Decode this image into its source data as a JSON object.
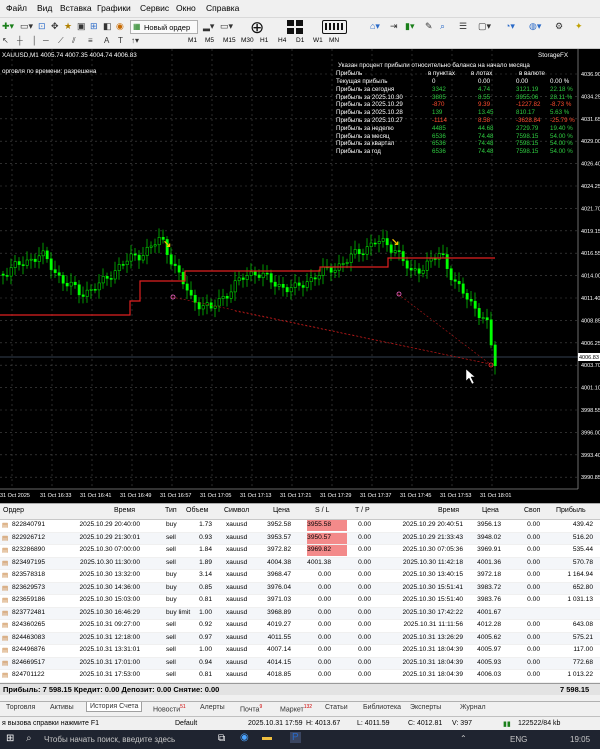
{
  "menu": [
    "Файл",
    "Вид",
    "Вставка",
    "Графики",
    "Сервис",
    "Окно",
    "Справка"
  ],
  "toolbar": {
    "new_order": "Новый ордер"
  },
  "timeframes": [
    "M1",
    "M5",
    "M15",
    "M30",
    "H1",
    "H4",
    "D1",
    "W1",
    "MN"
  ],
  "chart": {
    "title": "XAUUSD,M1 4005.74 4007.35 4004.74 4006.83",
    "subtitle": "орговля по времени: разрешена",
    "indicator": "StorageFX",
    "price_axis": [
      "4036.90",
      "4034.25",
      "4031.65",
      "4029.00",
      "4026.40",
      "4024.25",
      "4021.70",
      "4019.15",
      "4016.55",
      "4014.00",
      "4011.40",
      "4008.85",
      "4006.25",
      "4003.70",
      "4001.10",
      "3998.55",
      "3996.00",
      "3993.40",
      "3990.85"
    ],
    "current_price": "4006.83",
    "time_axis": [
      "31 Oct 2025",
      "31 Oct 16:33",
      "31 Oct 16:41",
      "31 Oct 16:49",
      "31 Oct 16:57",
      "31 Oct 17:05",
      "31 Oct 17:13",
      "31 Oct 17:21",
      "31 Oct 17:29",
      "31 Oct 17:37",
      "31 Oct 17:45",
      "31 Oct 17:53",
      "31 Oct 18:01"
    ]
  },
  "stats": {
    "header": "Указан процент прибыли относительно баланса на начало месяца",
    "cols": [
      "Прибыль",
      "в пунктах",
      "в лотах",
      "в валюте"
    ],
    "rows": [
      {
        "label": "Текущая прибыль",
        "pts": "0",
        "lots": "0.00",
        "cur": "0.00",
        "pct": "0.00 %",
        "color": "#ffffff"
      },
      {
        "label": "Прибыль за сегодня",
        "pts": "3342",
        "lots": "4.74",
        "cur": "3121.19",
        "pct": "22.18 %",
        "color": "#2ecc40"
      },
      {
        "label": "Прибыль за 2025.10.30",
        "pts": "3805",
        "lots": "8.55",
        "cur": "3955.06",
        "pct": "28.11 %",
        "color": "#2ecc40"
      },
      {
        "label": "Прибыль за 2025.10.29",
        "pts": "-870",
        "lots": "9.39",
        "cur": "-1227.82",
        "pct": "-8.73 %",
        "color": "#ff4d2e"
      },
      {
        "label": "Прибыль за 2025.10.28",
        "pts": "139",
        "lots": "13.45",
        "cur": "810.17",
        "pct": "5.63 %",
        "color": "#2ecc40"
      },
      {
        "label": "Прибыль за 2025.10.27",
        "pts": "-1114",
        "lots": "8.58",
        "cur": "-3628.84",
        "pct": "-25.79 %",
        "color": "#ff4d2e"
      },
      {
        "label": "Прибыль за неделю",
        "pts": "4485",
        "lots": "44.68",
        "cur": "2729.79",
        "pct": "19.40 %",
        "color": "#2ecc40"
      },
      {
        "label": "Прибыль за месяц",
        "pts": "6536",
        "lots": "74.48",
        "cur": "7598.15",
        "pct": "54.00 %",
        "color": "#2ecc40"
      },
      {
        "label": "Прибыль за квартал",
        "pts": "6536",
        "lots": "74.48",
        "cur": "7598.15",
        "pct": "54.00 %",
        "color": "#2ecc40"
      },
      {
        "label": "Прибыль за год",
        "pts": "6536",
        "lots": "74.48",
        "cur": "7598.15",
        "pct": "54.00 %",
        "color": "#2ecc40"
      }
    ]
  },
  "table": {
    "headers": [
      "Ордер",
      "Время",
      "Тип",
      "Объем",
      "Символ",
      "Цена",
      "S / L",
      "T / P",
      "Время",
      "Цена",
      "Своп",
      "Прибыль"
    ],
    "rows": [
      {
        "order": "822840791",
        "time": "2025.10.29 20:40:00",
        "type": "buy",
        "vol": "1.73",
        "sym": "xauusd",
        "price": "3952.58",
        "sl": "3955.58",
        "tp": "0.00",
        "ctime": "2025.10.29 20:40:51",
        "cprice": "3956.13",
        "swap": "0.00",
        "profit": "439.42",
        "slhl": true
      },
      {
        "order": "822926712",
        "time": "2025.10.29 21:30:01",
        "type": "sell",
        "vol": "0.93",
        "sym": "xauusd",
        "price": "3953.57",
        "sl": "3950.57",
        "tp": "0.00",
        "ctime": "2025.10.29 21:33:43",
        "cprice": "3948.02",
        "swap": "0.00",
        "profit": "516.20",
        "slhl": true
      },
      {
        "order": "823286890",
        "time": "2025.10.30 07:00:00",
        "type": "sell",
        "vol": "1.84",
        "sym": "xauusd",
        "price": "3972.82",
        "sl": "3969.82",
        "tp": "0.00",
        "ctime": "2025.10.30 07:05:36",
        "cprice": "3969.91",
        "swap": "0.00",
        "profit": "535.44",
        "slhl": true
      },
      {
        "order": "823497195",
        "time": "2025.10.30 11:30:00",
        "type": "sell",
        "vol": "1.89",
        "sym": "xauusd",
        "price": "4004.38",
        "sl": "4001.38",
        "tp": "0.00",
        "ctime": "2025.10.30 11:42:18",
        "cprice": "4001.36",
        "swap": "0.00",
        "profit": "570.78",
        "slhl": false
      },
      {
        "order": "823578318",
        "time": "2025.10.30 13:32:00",
        "type": "buy",
        "vol": "3.14",
        "sym": "xauusd",
        "price": "3968.47",
        "sl": "0.00",
        "tp": "0.00",
        "ctime": "2025.10.30 13:40:15",
        "cprice": "3972.18",
        "swap": "0.00",
        "profit": "1 164.94",
        "slhl": false
      },
      {
        "order": "823629573",
        "time": "2025.10.30 14:36:00",
        "type": "buy",
        "vol": "0.85",
        "sym": "xauusd",
        "price": "3976.04",
        "sl": "0.00",
        "tp": "0.00",
        "ctime": "2025.10.30 15:51:41",
        "cprice": "3983.72",
        "swap": "0.00",
        "profit": "652.80",
        "slhl": false
      },
      {
        "order": "823659186",
        "time": "2025.10.30 15:03:00",
        "type": "buy",
        "vol": "0.81",
        "sym": "xauusd",
        "price": "3971.03",
        "sl": "0.00",
        "tp": "0.00",
        "ctime": "2025.10.30 15:51:40",
        "cprice": "3983.76",
        "swap": "0.00",
        "profit": "1 031.13",
        "slhl": false
      },
      {
        "order": "823772481",
        "time": "2025.10.30 16:46:29",
        "type": "buy limit",
        "vol": "1.00",
        "sym": "xauusd",
        "price": "3968.89",
        "sl": "0.00",
        "tp": "0.00",
        "ctime": "2025.10.30 17:42:22",
        "cprice": "4001.67",
        "swap": "",
        "profit": "",
        "slhl": false
      },
      {
        "order": "824360265",
        "time": "2025.10.31 09:27:00",
        "type": "sell",
        "vol": "0.92",
        "sym": "xauusd",
        "price": "4019.27",
        "sl": "0.00",
        "tp": "0.00",
        "ctime": "2025.10.31 11:11:56",
        "cprice": "4012.28",
        "swap": "0.00",
        "profit": "643.08",
        "slhl": false
      },
      {
        "order": "824463083",
        "time": "2025.10.31 12:18:00",
        "type": "sell",
        "vol": "0.97",
        "sym": "xauusd",
        "price": "4011.55",
        "sl": "0.00",
        "tp": "0.00",
        "ctime": "2025.10.31 13:26:29",
        "cprice": "4005.62",
        "swap": "0.00",
        "profit": "575.21",
        "slhl": false
      },
      {
        "order": "824496876",
        "time": "2025.10.31 13:31:01",
        "type": "sell",
        "vol": "1.00",
        "sym": "xauusd",
        "price": "4007.14",
        "sl": "0.00",
        "tp": "0.00",
        "ctime": "2025.10.31 18:04:39",
        "cprice": "4005.97",
        "swap": "0.00",
        "profit": "117.00",
        "slhl": false
      },
      {
        "order": "824669517",
        "time": "2025.10.31 17:01:00",
        "type": "sell",
        "vol": "0.94",
        "sym": "xauusd",
        "price": "4014.15",
        "sl": "0.00",
        "tp": "0.00",
        "ctime": "2025.10.31 18:04:39",
        "cprice": "4005.93",
        "swap": "0.00",
        "profit": "772.68",
        "slhl": false
      },
      {
        "order": "824701122",
        "time": "2025.10.31 17:53:00",
        "type": "sell",
        "vol": "0.81",
        "sym": "xauusd",
        "price": "4018.85",
        "sl": "0.00",
        "tp": "0.00",
        "ctime": "2025.10.31 18:04:39",
        "cprice": "4006.03",
        "swap": "0.00",
        "profit": "1 013.22",
        "slhl": false
      }
    ]
  },
  "summary": {
    "text": "Прибыль: 7 598.15  Кредит: 0.00  Депозит: 0.00  Снятие: 0.00",
    "total": "7 598.15"
  },
  "tabs": [
    {
      "label": "Торговля",
      "badge": ""
    },
    {
      "label": "Активы",
      "badge": ""
    },
    {
      "label": "История Счета",
      "badge": ""
    },
    {
      "label": "Новости",
      "badge": "51"
    },
    {
      "label": "Алерты",
      "badge": ""
    },
    {
      "label": "Почта",
      "badge": "9"
    },
    {
      "label": "Маркет",
      "badge": "132"
    },
    {
      "label": "Статьи",
      "badge": ""
    },
    {
      "label": "Библиотека",
      "badge": ""
    },
    {
      "label": "Эксперты",
      "badge": ""
    },
    {
      "label": "Журнал",
      "badge": ""
    }
  ],
  "status": {
    "help": "я вызова справки нажмите F1",
    "profile": "Default",
    "datetime": "2025.10.31 17:59",
    "o": "O: 4013.77",
    "h": "H: 4013.67",
    "l": "L: 4011.59",
    "c": "C: 4012.81",
    "v": "V: 397",
    "traffic": "122522/84 kb"
  },
  "taskbar": {
    "search": "Чтобы начать поиск, введите здесь",
    "lang": "ENG",
    "time": "19:05"
  }
}
